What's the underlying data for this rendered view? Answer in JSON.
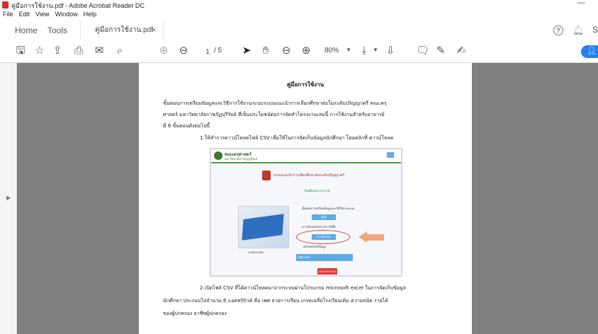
{
  "window": {
    "title": "คู่มือการใช้งาน.pdf - Adobe Acrobat Reader DC",
    "minimize": "—"
  },
  "menu": [
    "File",
    "Edit",
    "View",
    "Window",
    "Help"
  ],
  "tabs": {
    "home": "Home",
    "tools": "Tools",
    "document": "คู่มือการใช้งาน.pdf",
    "close": "×"
  },
  "header": {
    "help": "?",
    "signin_edge": "S"
  },
  "toolbar": {
    "page_current": "1",
    "page_total": "/ 5",
    "zoom": "80%"
  },
  "icons": [
    "save-icon",
    "star-icon",
    "upload-icon",
    "print-icon",
    "mail-icon",
    "search-icon",
    "page-up-icon",
    "page-down-icon",
    "select-icon",
    "hand-icon",
    "zoom-out-icon",
    "zoom-in-icon",
    "fit-page-icon",
    "scroll-mode-icon",
    "comment-icon",
    "highlight-icon",
    "sign-icon",
    "bell-icon",
    "add-user-icon"
  ],
  "document": {
    "title": "คู่มือการใช้งาน",
    "para1": [
      "ขั้นตอนการเตรียมข้อมูลและวิธีการใช้งานระบบระบบแนะนำการเลือกศึกษาต่อในระดับปริญญาตรี คณะครุ",
      "ศาสตร์ มหาวิทยาลัยราชภัฏบุรีรัมย์ ที่เป็นประโยชน์ต่อการจัดทำโครงงานเล่มนี้ การใช้งานสำหรับอาจารย์",
      "มี 6 ขั้นตอนดังต่อไปนี้"
    ],
    "step1": "1.ให้ทำการดาวน์โหลดไฟล์ CSV เพื่อใช้ในการจัดเก็บข้อมูลนักศึกษา โดยคลิกที่ ดาวน์โหลด",
    "step2": [
      "2.เปิดไฟล์  CSV ที่ได้ดาวน์โหลดมาจากระบบผ่านโปรแกรม microsoft excel ในการจัดเก็บข้อมูล",
      "นักศึกษา ประกอบไปจำนวน 6 แอตทริบิวต์ คือ เพศ สายการเรียน เกรดเฉลี่ยโรงเรียนเดิม ความถนัด รายได้",
      "ของผู้ปกครอง อาชีพผู้ปกครอง"
    ]
  },
  "embedded": {
    "brand": "คณะครุศาสตร์",
    "brand_sub": "มหาวิทยาลัยราชภัฏบุรีรัมย์",
    "heading": "ระบบแนะนำการเลือกศึกษาต่อระดับปริญญาตรี",
    "welcome": "ยินดีต้อนรับ อาจารย์",
    "photo_caption": "ภาพประกอบ",
    "note1": "ขั้นตอนการเตรียมข้อมูลและวิธีใช้งานระบบ",
    "btn1": "คู่มือ",
    "note2": "ดาวน์โหลดไฟล์ CSV ได้ที่นี่",
    "btn2": "ดาวน์โหลด",
    "note3": "อัปโหลดไฟล์ข้อมูล",
    "bar": "เลือกไฟล์",
    "logout": "ออกจากระบบ"
  }
}
